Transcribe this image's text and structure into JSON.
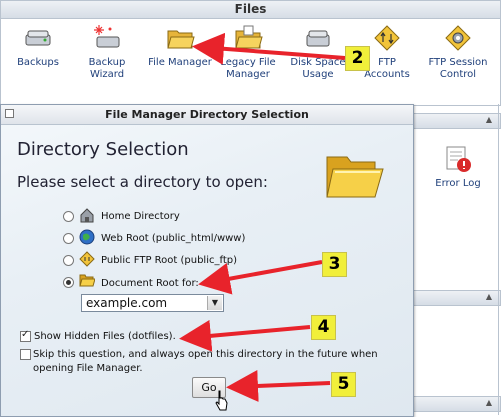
{
  "files_panel": {
    "title": "Files",
    "tools": [
      {
        "label": "Backups",
        "icon": "backups-icon"
      },
      {
        "label": "Backup Wizard",
        "icon": "backup-wizard-icon"
      },
      {
        "label": "File Manager",
        "icon": "file-manager-icon"
      },
      {
        "label": "Legacy File Manager",
        "icon": "legacy-file-manager-icon"
      },
      {
        "label": "Disk Space Usage",
        "icon": "disk-space-icon"
      },
      {
        "label": "FTP Accounts",
        "icon": "ftp-accounts-icon"
      },
      {
        "label": "FTP Session Control",
        "icon": "ftp-session-icon"
      }
    ]
  },
  "background": {
    "error_log": "Error Log"
  },
  "dialog": {
    "title": "File Manager Directory Selection",
    "heading": "Directory Selection",
    "prompt": "Please select a directory to open:",
    "options": [
      {
        "label": "Home Directory",
        "icon": "home-icon",
        "selected": false
      },
      {
        "label": "Web Root (public_html/www)",
        "icon": "globe-icon",
        "selected": false
      },
      {
        "label": "Public FTP Root (public_ftp)",
        "icon": "ftp-icon",
        "selected": false
      },
      {
        "label": "Document Root for:",
        "icon": "folder-icon",
        "selected": true
      }
    ],
    "domain_select": {
      "value": "example.com"
    },
    "show_hidden": {
      "label": "Show Hidden Files (dotfiles).",
      "checked": true
    },
    "skip_question": {
      "label": "Skip this question, and always open this directory in the future when opening File Manager.",
      "checked": false
    },
    "go_label": "Go"
  },
  "callouts": [
    "2",
    "3",
    "4",
    "5"
  ],
  "colors": {
    "callout_arrow": "#e8232b",
    "callout_badge": "#f1ef3a",
    "link_text": "#1f3f7a"
  }
}
